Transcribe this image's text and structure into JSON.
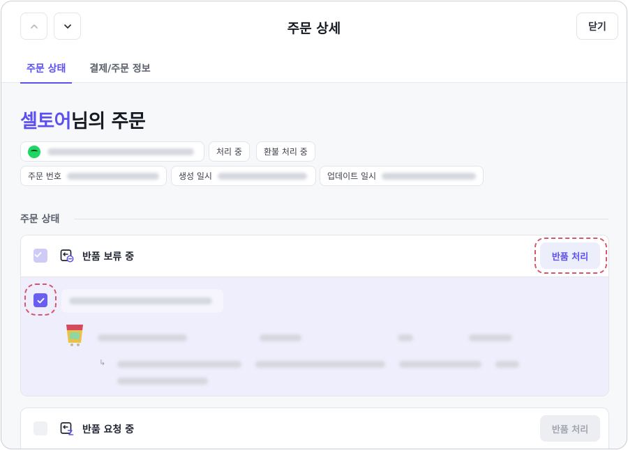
{
  "header": {
    "title": "주문 상세",
    "close_label": "닫기",
    "nav_up_icon": "chevron-up-icon",
    "nav_down_icon": "chevron-down-icon"
  },
  "tabs": [
    {
      "label": "주문 상태",
      "active": true
    },
    {
      "label": "결제/주문 정보",
      "active": false
    }
  ],
  "greeting": {
    "name": "셀토어",
    "suffix": "님의 주문"
  },
  "chips": {
    "status_1": "처리 중",
    "status_2": "환불 처리 중",
    "order_number_label": "주문 번호",
    "created_label": "생성 일시",
    "updated_label": "업데이트 일시"
  },
  "section": {
    "label": "주문 상태"
  },
  "groups": [
    {
      "label": "반품 보류 중",
      "button": "반품 처리",
      "button_enabled": true
    },
    {
      "label": "반품 요청 중",
      "button": "반품 처리",
      "button_enabled": false
    }
  ],
  "colors": {
    "accent": "#5b4ff0",
    "highlight_dash": "#d7566b",
    "spotify_green": "#1ed760"
  }
}
